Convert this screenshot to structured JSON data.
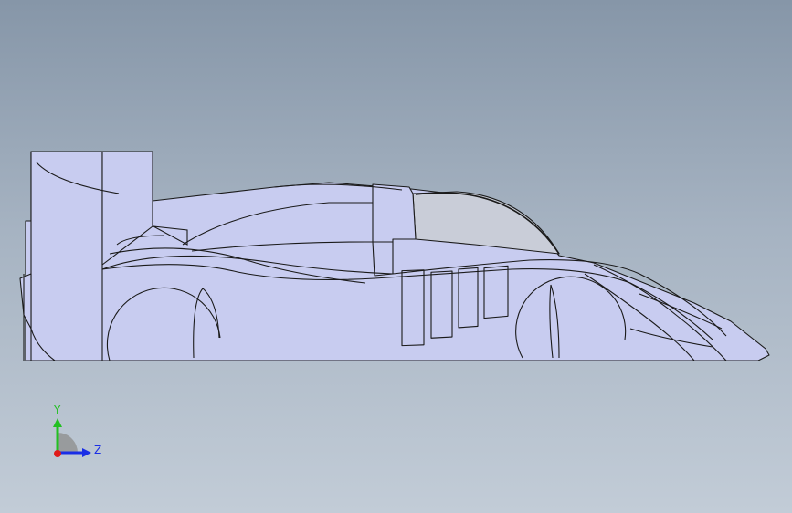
{
  "viewport": {
    "background_top": "#8696a8",
    "background_bottom": "#c2ccd7"
  },
  "model": {
    "body_color": "#c8ccf0",
    "canopy_color": "#c9cdd8",
    "line_color": "#1a1a1a"
  },
  "triad": {
    "y_label": "Y",
    "z_label": "Z",
    "y_color": "#22c022",
    "z_color": "#1a2ee6",
    "x_color": "#e01a1a"
  }
}
